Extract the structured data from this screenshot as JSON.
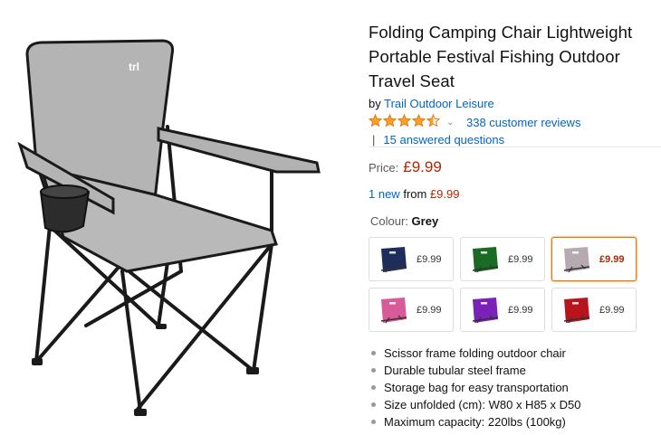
{
  "product": {
    "title": "Folding Camping Chair Lightweight Portable Festival Fishing Outdoor Travel Seat",
    "by_prefix": "by",
    "brand": "Trail Outdoor Leisure",
    "image_logo": "trl",
    "rating": 4.5,
    "rating_icon": "star-rating-icon",
    "review_count_text": "338 customer reviews",
    "questions_text": "15 answered questions",
    "separator": "|"
  },
  "pricing": {
    "label": "Price:",
    "value": "£9.99",
    "new_count": "1 new",
    "from_text": "from",
    "new_price": "£9.99",
    "color": "#b12704"
  },
  "colour": {
    "label": "Colour:",
    "selected": "Grey",
    "swatches": [
      {
        "price": "£9.99",
        "hex": "#1e2d5c",
        "selected": false
      },
      {
        "price": "£9.99",
        "hex": "#1a6b24",
        "selected": false
      },
      {
        "price": "£9.99",
        "hex": "#b6aab0",
        "selected": true
      },
      {
        "price": "£9.99",
        "hex": "#d95a98",
        "selected": false
      },
      {
        "price": "£9.99",
        "hex": "#7a22b8",
        "selected": false
      },
      {
        "price": "£9.99",
        "hex": "#b8141e",
        "selected": false
      }
    ]
  },
  "features": [
    "Scissor frame folding outdoor chair",
    "Durable tubular steel frame",
    "Storage bag for easy transportation",
    "Size unfolded (cm): W80 x H85 x D50",
    "Maximum capacity: 220lbs (100kg)"
  ],
  "colors": {
    "link": "#0066c0",
    "star": "#ffa41c",
    "selected_border": "#e77600"
  }
}
